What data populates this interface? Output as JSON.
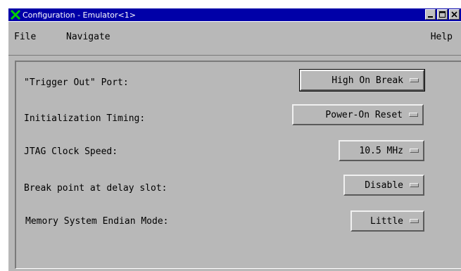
{
  "window": {
    "title": "Configuration - Emulator<1>",
    "icon": "x-logo-icon",
    "controls": [
      "minimize-icon",
      "maximize-icon",
      "close-icon"
    ]
  },
  "menubar": {
    "file": "File",
    "navigate": "Navigate",
    "help": "Help"
  },
  "settings": [
    {
      "label": "\"Trigger Out\" Port:",
      "value": "High On Break"
    },
    {
      "label": "Initialization Timing:",
      "value": "Power-On Reset"
    },
    {
      "label": "JTAG Clock Speed:",
      "value": "10.5 MHz"
    },
    {
      "label": "Break point at delay slot:",
      "value": "Disable"
    },
    {
      "label": "Memory System Endian Mode:",
      "value": "Little"
    }
  ],
  "colors": {
    "titlebar": "#0000a8",
    "window_bg": "#b8b8b8",
    "icon_green": "#00c000"
  }
}
